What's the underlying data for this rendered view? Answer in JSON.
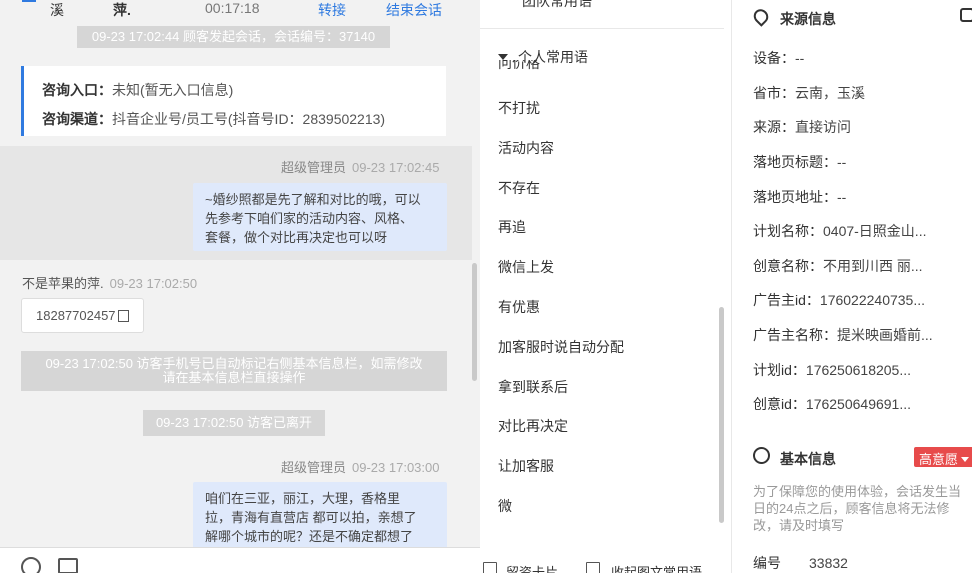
{
  "chat": {
    "top": {
      "name_left": "溪",
      "name_mid": "萍.",
      "duration": "00:17:18",
      "transfer": "转接",
      "end_session": "结束会话"
    },
    "sys_start": "09-23 17:02:44 顾客发起会话，会话编号：37140",
    "entry": {
      "label1": "咨询入口：",
      "value1": "未知(暂无入口信息)",
      "label2": "咨询渠道：",
      "value2": "抖音企业号/员工号(抖音号ID：2839502213)"
    },
    "msg1": {
      "sender": "超级管理员",
      "time": "09-23 17:02:45",
      "lines": [
        "~婚纱照都是先了解和对比的哦，可以",
        "先参考下咱们家的活动内容、风格、",
        "套餐，做个对比再决定也可以呀"
      ]
    },
    "msg2": {
      "sender": "不是苹果的萍.",
      "time": "09-23 17:02:50",
      "phone": "18287702457"
    },
    "sys_phone": {
      "line1": "09-23 17:02:50 访客手机号已自动标记右侧基本信息栏，如需修改",
      "line2": "请在基本信息栏直接操作"
    },
    "sys_left": "09-23 17:02:50 访客已离开",
    "msg3": {
      "sender": "超级管理员",
      "time": "09-23 17:03:00",
      "lines": [
        "咱们在三亚，丽江，大理，香格里",
        "拉，青海有直营店 都可以拍，亲想了",
        "解哪个城市的呢？还是不确定都想了"
      ]
    }
  },
  "phrases": {
    "team_header": "团队常用语",
    "personal_header": "个人常用语",
    "clipped_item": "问价格",
    "items": [
      "不打扰",
      "活动内容",
      "不存在",
      "再追",
      "微信上发",
      "有优惠",
      "加客服时说自动分配",
      "拿到联系后",
      "对比再决定",
      "让加客服",
      "微"
    ],
    "bottom_left": "留资卡片",
    "bottom_right": "收起图文常用语"
  },
  "info": {
    "source_title": "来源信息",
    "rows": [
      {
        "label": "设备：",
        "value": "--"
      },
      {
        "label": "省市：",
        "value": "云南，玉溪"
      },
      {
        "label": "来源：",
        "value": "直接访问"
      },
      {
        "label": "落地页标题：",
        "value": "--"
      },
      {
        "label": "落地页地址：",
        "value": "--"
      },
      {
        "label": "计划名称：",
        "value": "0407-日照金山..."
      },
      {
        "label": "创意名称：",
        "value": "不用到川西 丽..."
      },
      {
        "label": "广告主id：",
        "value": "176022240735..."
      },
      {
        "label": "广告主名称：",
        "value": "提米映画婚前..."
      },
      {
        "label": "计划id：",
        "value": "176250618205..."
      },
      {
        "label": "创意id：",
        "value": "176250649691..."
      }
    ],
    "basic_title": "基本信息",
    "badge": "高意愿",
    "notice": "为了保障您的使用体验，会话发生当日的24点之后，顾客信息将无法修改，请及时填写",
    "serial_label": "编号",
    "serial_value": "33832"
  },
  "colors": {
    "accent": "#2f7ae0",
    "bubble": "#dfe9fb",
    "badge": "#e74b4b"
  }
}
